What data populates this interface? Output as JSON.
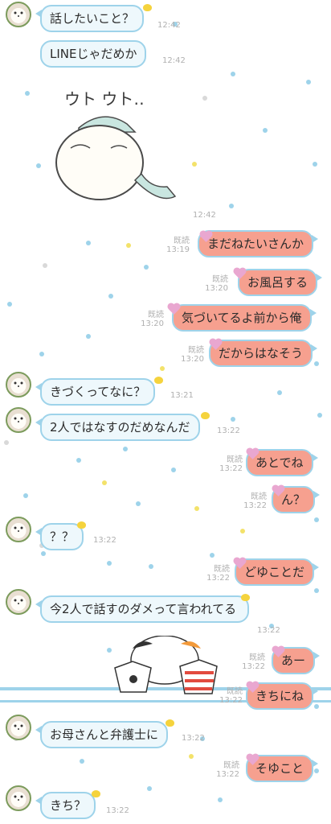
{
  "messages": [
    {
      "dir": "in",
      "text": "話したいこと？",
      "time": "12:42"
    },
    {
      "dir": "in",
      "text": "LINEじゃだめか",
      "time": "12:42"
    },
    {
      "dir": "in",
      "type": "sticker",
      "caption": "ウト ウト‥",
      "time": "12:42"
    },
    {
      "dir": "out",
      "text": "まだねたいさんか",
      "read": "既読",
      "time": "13:19"
    },
    {
      "dir": "out",
      "text": "お風呂する",
      "read": "既読",
      "time": "13:20"
    },
    {
      "dir": "out",
      "text": "気づいてるよ前から俺",
      "read": "既読",
      "time": "13:20"
    },
    {
      "dir": "out",
      "text": "だからはなそう",
      "read": "既読",
      "time": "13:20"
    },
    {
      "dir": "in",
      "text": "きづくってなに？",
      "time": "13:21"
    },
    {
      "dir": "in",
      "text": "2人ではなすのだめなんだ",
      "time": "13:22"
    },
    {
      "dir": "out",
      "text": "あとでね",
      "read": "既読",
      "time": "13:22"
    },
    {
      "dir": "out",
      "text": "ん？",
      "read": "既読",
      "time": "13:22"
    },
    {
      "dir": "in",
      "text": "？？",
      "time": "13:22"
    },
    {
      "dir": "out",
      "text": "どゆことだ",
      "read": "既読",
      "time": "13:22"
    },
    {
      "dir": "in",
      "text": "今2人で話すのダメって言われてる",
      "time": "13:22"
    },
    {
      "dir": "out",
      "text": "あー",
      "read": "既読",
      "time": "13:22"
    },
    {
      "dir": "out",
      "text": "きちにね",
      "read": "既読",
      "time": "13:22"
    },
    {
      "dir": "in",
      "text": "お母さんと弁護士に",
      "time": "13:22"
    },
    {
      "dir": "out",
      "text": "そゆこと",
      "read": "既読",
      "time": "13:22"
    },
    {
      "dir": "in",
      "text": "きち？",
      "time": "13:22"
    }
  ],
  "colors": {
    "incoming_bg": "#eef8fc",
    "outgoing_bg": "#f6a08f",
    "bubble_border": "#9ed3ea",
    "meta_text": "#b0b0b0"
  },
  "icons": [
    "avatar-icon",
    "duck-icon",
    "heart-icon",
    "sleepy-bear-sticker",
    "cat-laundry-sticker"
  ]
}
